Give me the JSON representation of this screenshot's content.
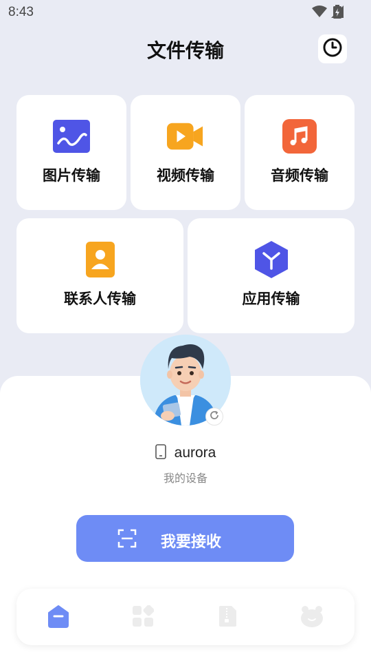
{
  "status_bar": {
    "time": "8:43"
  },
  "header": {
    "title": "文件传输"
  },
  "cards": [
    {
      "label": "图片传输",
      "icon": "image-icon",
      "color": "#4f55e6"
    },
    {
      "label": "视频传输",
      "icon": "video-icon",
      "color": "#f7a51f"
    },
    {
      "label": "音频传输",
      "icon": "music-icon",
      "color": "#f2663a"
    },
    {
      "label": "联系人传输",
      "icon": "contact-icon",
      "color": "#f7a51f"
    },
    {
      "label": "应用传输",
      "icon": "app-cube-icon",
      "color": "#4f55e6"
    }
  ],
  "device": {
    "name": "aurora",
    "subtitle": "我的设备"
  },
  "receive_button": {
    "label": "我要接收"
  },
  "bottom_nav": {
    "items": [
      "home-icon",
      "apps-icon",
      "archive-icon",
      "mascot-icon"
    ],
    "active_color": "#6e8cf5",
    "inactive_color": "#ececec"
  }
}
